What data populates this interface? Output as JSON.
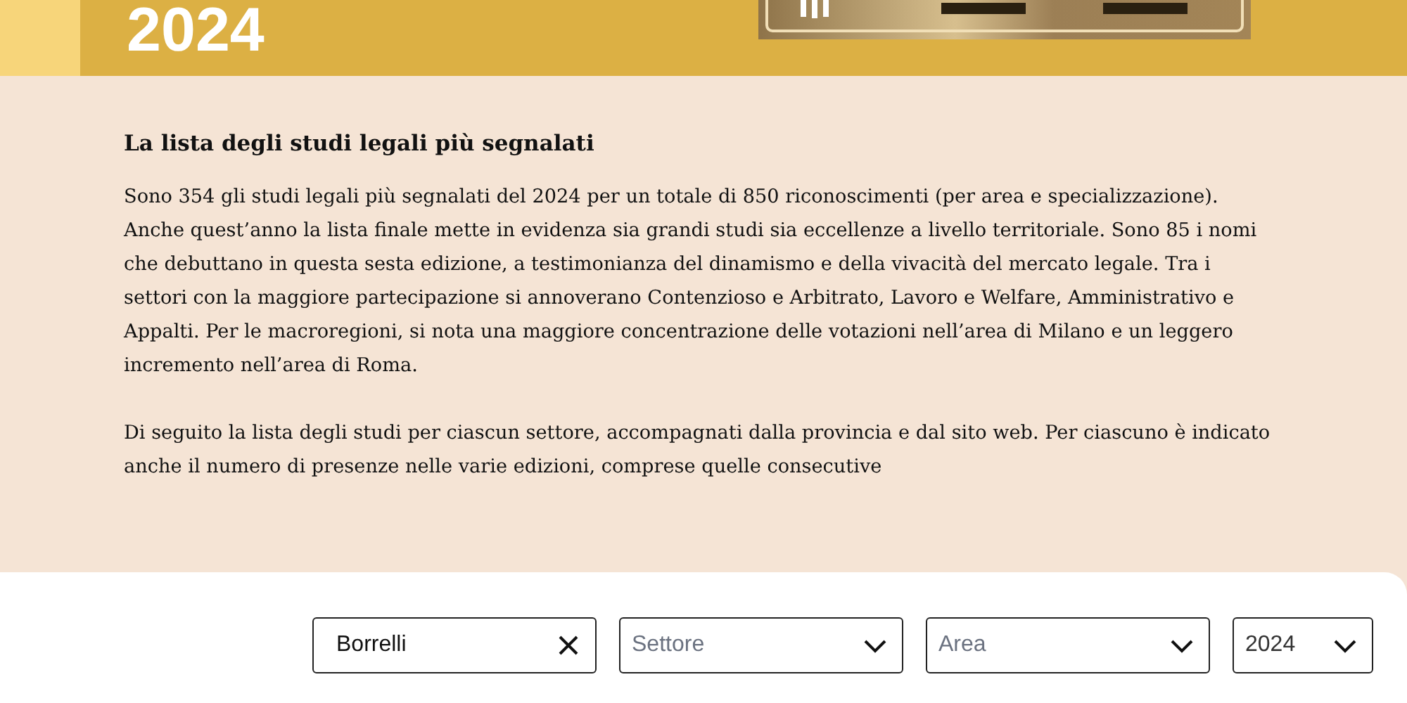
{
  "banner": {
    "year": "2024"
  },
  "intro": {
    "title": "La lista degli studi legali più segnalati",
    "paragraphs": [
      "Sono 354 gli studi legali più segnalati del 2024 per un totale di 850 riconoscimenti (per area e specializzazione). Anche quest’anno la lista finale mette in evidenza sia grandi studi sia eccellenze a livello territoriale. Sono 85 i nomi che debuttano in questa sesta edizione, a testimonianza del dinamismo e della vivacità del mercato legale. Tra i settori con la maggiore partecipazione si annoverano Contenzioso e Arbitrato, Lavoro e Welfare, Amministrativo e Appalti. Per le macroregioni, si nota una maggiore concentrazione delle votazioni nell’area di Milano e un leggero incremento nell’area di Roma.",
      "Di seguito la lista degli studi per ciascun settore, accompagnati dalla provincia e dal sito web. Per ciascuno è indicato anche il numero di presenze nelle varie edizioni, comprese quelle consecutive"
    ]
  },
  "filters": {
    "search": {
      "value": "Borrelli"
    },
    "selects": [
      {
        "placeholder": "Settore"
      },
      {
        "placeholder": "Area"
      },
      {
        "value": "2024"
      }
    ]
  }
}
